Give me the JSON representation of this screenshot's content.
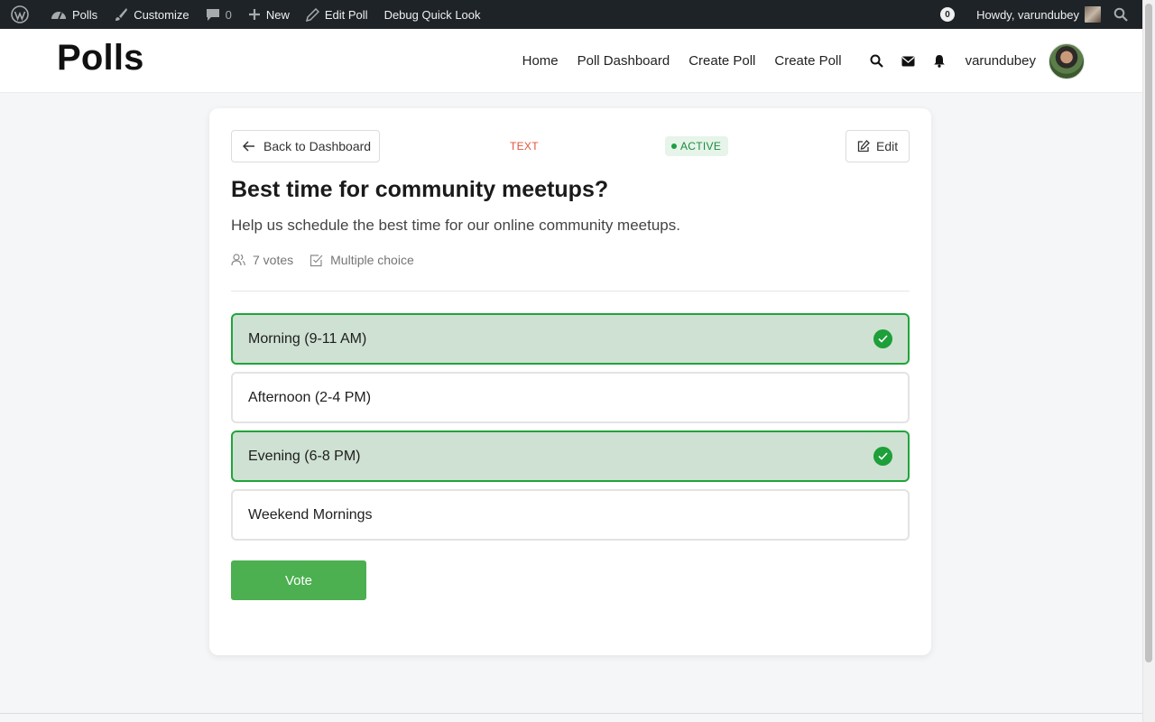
{
  "adminbar": {
    "site_name": "Polls",
    "customize": "Customize",
    "comments_count": "0",
    "new_label": "New",
    "edit_poll": "Edit Poll",
    "debug": "Debug Quick Look",
    "notif_count": "0",
    "howdy": "Howdy, varundubey"
  },
  "header": {
    "logo": "Polls",
    "nav": [
      "Home",
      "Poll Dashboard",
      "Create Poll",
      "Create Poll"
    ],
    "username": "varundubey"
  },
  "card": {
    "back_label": "Back to Dashboard",
    "type_label": "TEXT",
    "status": "ACTIVE",
    "edit_label": "Edit",
    "title": "Best time for community meetups?",
    "description": "Help us schedule the best time for our online community meetups.",
    "votes": "7 votes",
    "choice_type": "Multiple choice",
    "options": [
      {
        "label": "Morning (9-11 AM)",
        "selected": true
      },
      {
        "label": "Afternoon (2-4 PM)",
        "selected": false
      },
      {
        "label": "Evening (6-8 PM)",
        "selected": true
      },
      {
        "label": "Weekend Mornings",
        "selected": false
      }
    ],
    "vote_label": "Vote"
  },
  "colors": {
    "adminbar_bg": "#1d2327",
    "selected_border": "#1fa53a",
    "selected_bg": "#cfe1d2",
    "vote_button": "#4caf50",
    "type_label": "#e2543d",
    "status_text": "#1f8b3c"
  },
  "icons": {
    "adminbar": [
      "wordpress-logo-icon",
      "dashboard-icon",
      "brush-icon",
      "comment-icon",
      "plus-icon",
      "pencil-icon",
      "search-icon"
    ],
    "header": [
      "search-icon",
      "envelope-icon",
      "bell-icon"
    ],
    "card": [
      "arrow-left-icon",
      "edit-icon",
      "users-icon",
      "checkbox-icon",
      "check-icon"
    ]
  }
}
